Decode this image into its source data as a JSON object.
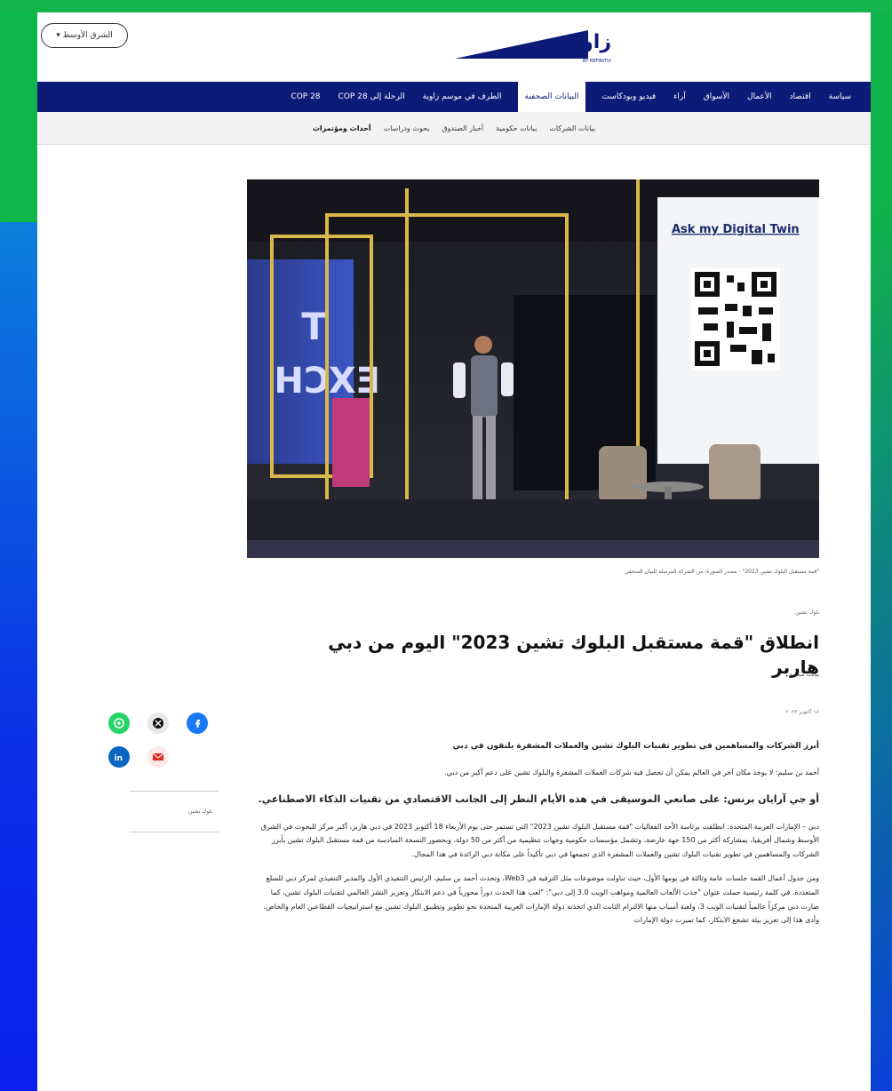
{
  "header": {
    "lang_button": "الشرق الأوسط ▾",
    "logo_text": "زاوية",
    "logo_sub": "BY REFINITIV"
  },
  "nav": {
    "primary": [
      "سياسة",
      "اقتصاد",
      "الأعمال",
      "الأسواق",
      "آراء",
      "فيديو وبودكاست",
      "البيانات الصحفية",
      "الطرف في موسم زاوية",
      "الرحلة إلى COP 28",
      "COP 28"
    ],
    "primary_active_index": 6,
    "secondary": [
      "بيانات الشركات",
      "بيانات حكومية",
      "أخبار الصندوق",
      "بحوث ودراسات",
      "أحداث ومؤتمرات"
    ],
    "secondary_active_index": 4
  },
  "hero": {
    "screen_text": "Ask my Digital Twin",
    "backdrop_text_1": "T",
    "backdrop_text_2": "EXCH"
  },
  "article": {
    "caption": "\"قمة مستقبل البلوك تشين 2023\" - مصدر الصورة: من الشركة المرسلة للبيان الصحفي",
    "section_label": "بلوك تشين",
    "title": "انطلاق \"قمة مستقبل البلوك تشين 2023\" اليوم من دبي هاربر",
    "source": "بيانات صحفية",
    "date": "١٨ أكتوبر ٢٠٢٣",
    "lead": "أبرز الشركات والمساهمين في تطوير تقنيات البلوك تشين والعملات المشفرة يلتقون في دبي",
    "quote": "أحمد بن سليم: لا يوجد مكان آخر في العالم يمكن أن تحصل فيه شركات العملات المشفرة والبلوك تشين على دعم أكبر من دبي.",
    "subhead": "أو جي آرايان برنس: على صانعي الموسيقى في هذه الأيام النظر إلى الجانب الاقتصادي من تقنيات الذكاء الاصطناعي.",
    "para1": "دبي – الإمارات العربية المتحدة: انطلقت برئاسة الأحد الفعاليات \"قمة مستقبل البلوك تشين 2023\" التي تستمر حتى يوم الأربعاء 18 أكتوبر 2023 في دبي هاربر، أكبر مركز للبحوث في الشرق الأوسط وشمال أفريقيا، بمشاركة أكثر من 150 جهة عارضة، وتشمل مؤسسات حكومية وجهات تنظيمية من أكثر من 50 دولة، وبحضور النسخة السادسة من قمة مستقبل البلوك تشين بأبرز الشركات والمساهمين في تطوير تقنيات البلوك تشين والعملات المشفرة الذي تجمعها في دبي تأكيداً على مكانة دبي الرائدة في هذا المجال.",
    "para2": "ومن جدول أعمال القمة جلسات عامة وثالثة في يومها الأول، حيث تناولت موضوعات مثل الترفيه في Web3، وتحدث أحمد بن سليم، الرئيس التنفيذي الأول والمدير التنفيذي لمركز دبي للسلع المتعددة، في كلمة رئيسية حملت عنوان \"جذب الألعاب العالمية ومواهب الويب 3.0 إلى دبي\": \"لعب هذا الحدث دوراً محورياً في دعم الابتكار وتعزيز النشر العالمي لتقنيات البلوك تشين، كما صارت دبي مركزاً عالمياً لتقنيات الويب 3، ولعبة أسباب منها الالتزام الثابت الذي اتخذته دولة الإمارات العربية المتحدة نحو تطوير وتطبيق البلوك تشين مع استراتيجيات القطاعين العام والخاص، وأدى هذا إلى تعزيز بيئة تشجع الابتكار، كما تميزت دولة الإمارات"
  },
  "share": {
    "label": "بلوك تشين",
    "icons": [
      "whatsapp-icon",
      "x-icon",
      "facebook-icon",
      "linkedin-icon",
      "email-icon"
    ]
  },
  "colors": {
    "nav_primary_bg": "#0d1b78",
    "nav_secondary_bg": "#f3f3f3",
    "page_bg_green": "#10b24a",
    "page_bg_blue": "#0a20ef",
    "whatsapp": "#25d366",
    "facebook": "#1877f2",
    "linkedin": "#0a66c2",
    "email": "#d93025",
    "x": "#111111"
  }
}
